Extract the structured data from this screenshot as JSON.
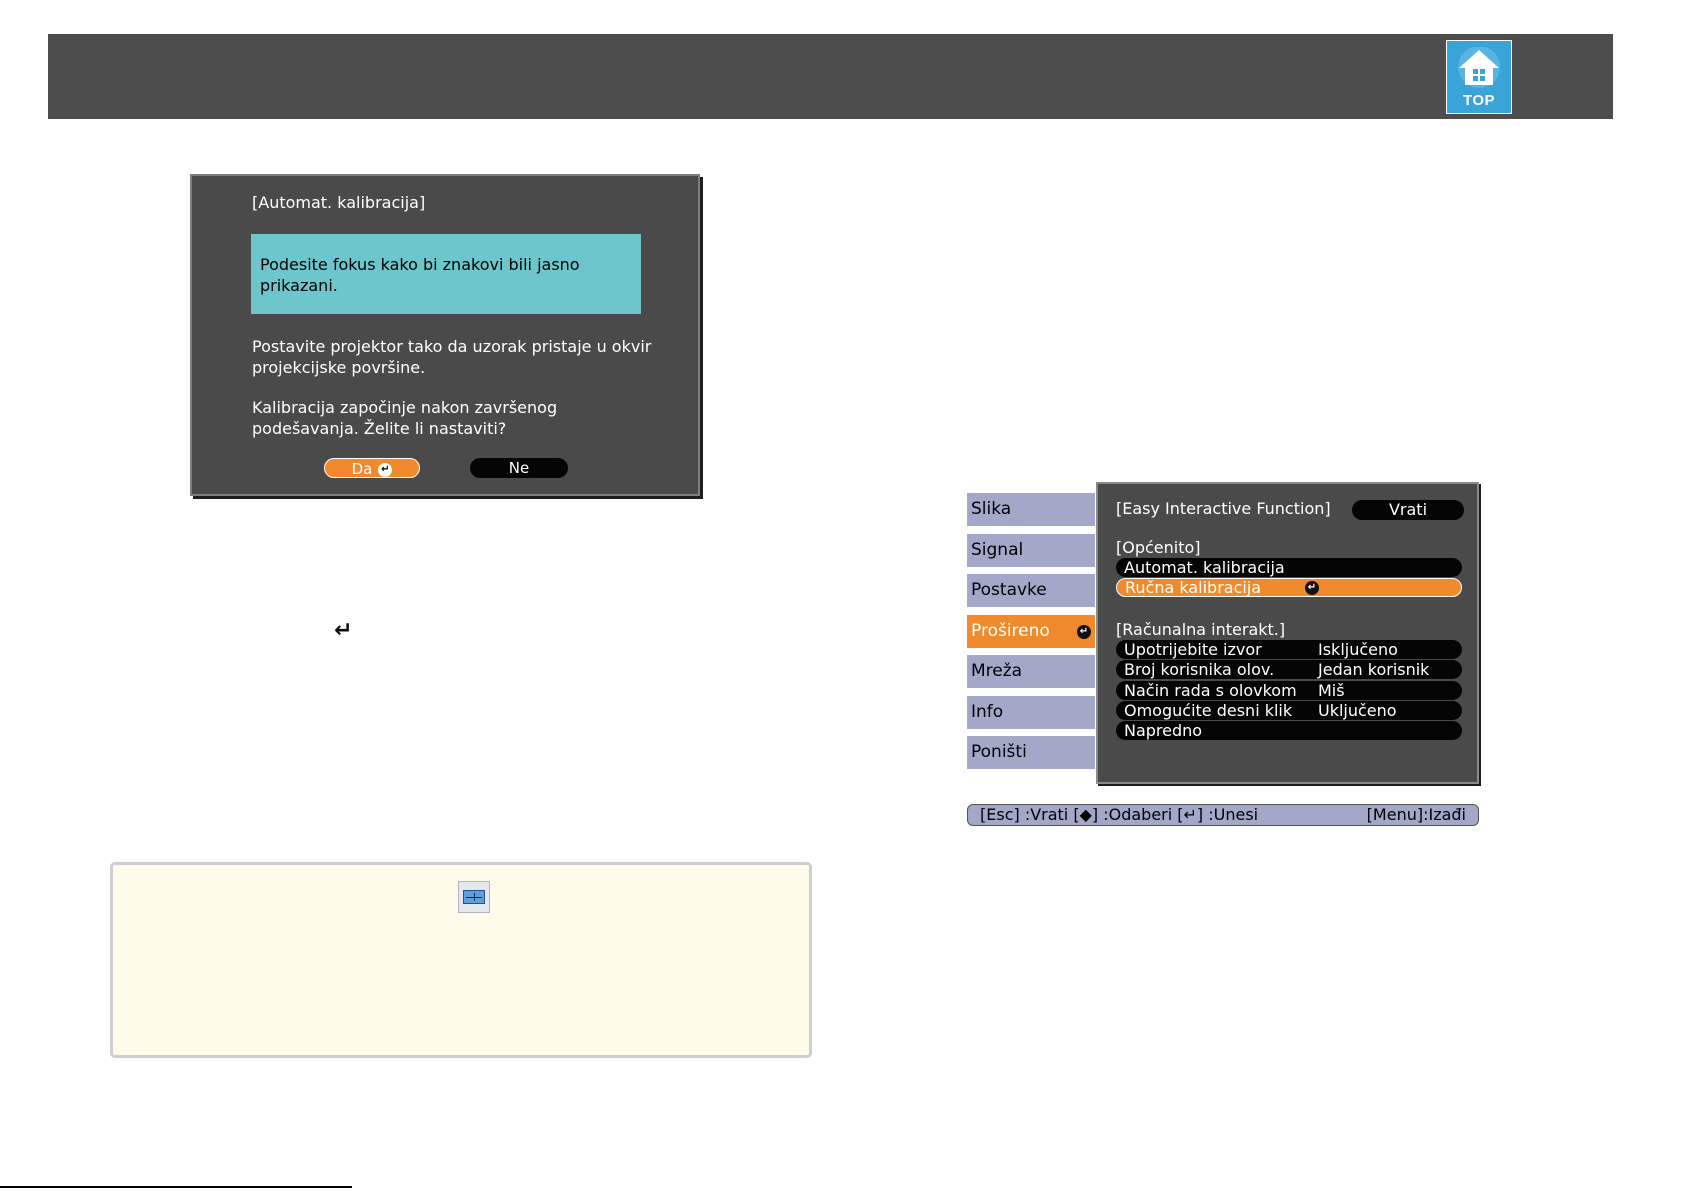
{
  "header": {
    "top_button_label": "TOP",
    "top_button_icon": "home-icon",
    "bar_color": "#4d4d4d"
  },
  "dialog": {
    "title": "[Automat. kalibracija]",
    "highlight_text": "Podesite fokus kako bi znakovi bili jasno prikazani.",
    "paragraph1": "Postavite projektor tako da uzorak pristaje u okvir projekcijske površine.",
    "paragraph2": "Kalibracija započinje nakon završenog podešavanja. Želite li nastaviti?",
    "yes_label": "Da",
    "no_label": "Ne"
  },
  "inline_enter_symbol": "↵",
  "note": {
    "icon": "calibration-icon"
  },
  "menu": {
    "sidebar": [
      {
        "label": "Slika"
      },
      {
        "label": "Signal"
      },
      {
        "label": "Postavke"
      },
      {
        "label": "Prošireno",
        "active": true
      },
      {
        "label": "Mreža"
      },
      {
        "label": "Info"
      },
      {
        "label": "Poništi"
      }
    ],
    "panel_title": "[Easy Interactive Function]",
    "back_label": "Vrati",
    "section_general": "[Općenito]",
    "general_items": [
      {
        "label": "Automat. kalibracija"
      },
      {
        "label": "Ručna kalibracija",
        "selected": true
      }
    ],
    "section_pc": "[Računalna interakt.]",
    "pc_items": [
      {
        "label": "Upotrijebite izvor",
        "value": "Isključeno"
      },
      {
        "label": "Broj korisnika olov.",
        "value": "Jedan korisnik"
      },
      {
        "label": "Način rada s olovkom",
        "value": "Miš"
      },
      {
        "label": "Omogućite desni klik",
        "value": "Uključeno"
      },
      {
        "label": "Napredno",
        "value": ""
      }
    ],
    "status_left": "[Esc] :Vrati  [◆] :Odaberi  [↵] :Unesi",
    "status_right": "[Menu]:Izađi",
    "accent_color": "#f08a2c",
    "sidebar_color": "#a3a8c8"
  }
}
